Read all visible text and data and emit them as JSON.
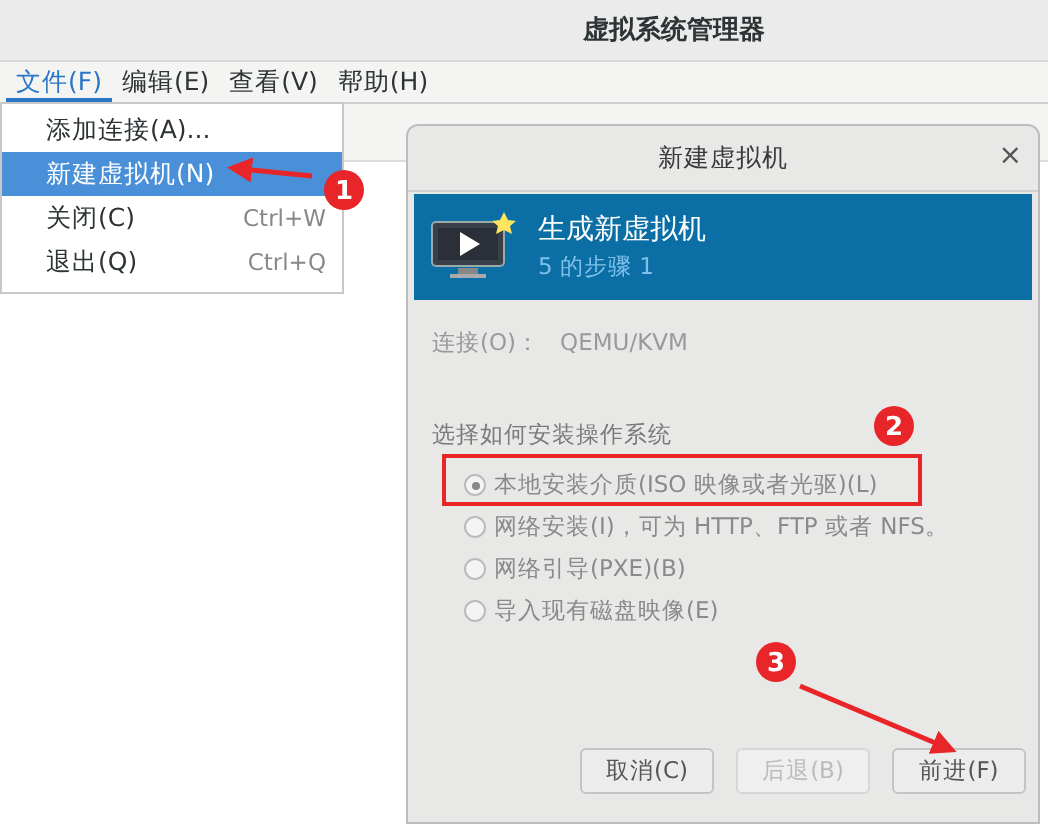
{
  "window": {
    "title": "虚拟系统管理器"
  },
  "menubar": [
    {
      "label": "文件(F)",
      "selected": true
    },
    {
      "label": "编辑(E)",
      "selected": false
    },
    {
      "label": "查看(V)",
      "selected": false
    },
    {
      "label": "帮助(H)",
      "selected": false
    }
  ],
  "file_menu": [
    {
      "label": "添加连接(A)...",
      "selected": false
    },
    {
      "label": "新建虚拟机(N)",
      "selected": true
    },
    {
      "label": "关闭(C)",
      "shortcut": "Ctrl+W",
      "selected": false
    },
    {
      "label": "退出(Q)",
      "shortcut": "Ctrl+Q",
      "selected": false
    }
  ],
  "dialog": {
    "title": "新建虚拟机",
    "close": "×",
    "header": {
      "title": "生成新虚拟机",
      "subtitle": "5 的步骤 1"
    },
    "connection": {
      "label": "连接(O)：",
      "value": "QEMU/KVM"
    },
    "section_label": "选择如何安装操作系统",
    "options": [
      {
        "label": "本地安装介质(ISO 映像或者光驱)(L)",
        "selected": true,
        "disabled": true
      },
      {
        "label": "网络安装(I)，可为 HTTP、FTP 或者 NFS。",
        "selected": false,
        "disabled": true
      },
      {
        "label": "网络引导(PXE)(B)",
        "selected": false,
        "disabled": true
      },
      {
        "label": "导入现有磁盘映像(E)",
        "selected": false,
        "disabled": true
      }
    ],
    "buttons": [
      {
        "label": "取消(C)",
        "disabled": false
      },
      {
        "label": "后退(B)",
        "disabled": true
      },
      {
        "label": "前进(F)",
        "disabled": false
      }
    ]
  },
  "annotations": [
    {
      "number": "1"
    },
    {
      "number": "2"
    },
    {
      "number": "3"
    }
  ]
}
